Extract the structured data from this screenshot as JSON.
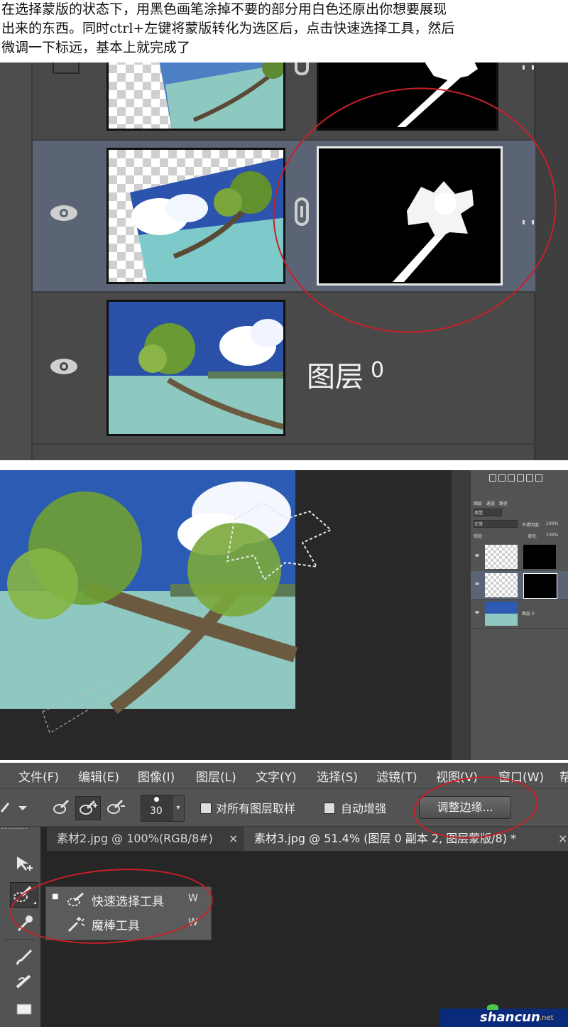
{
  "caption": {
    "line1": "在选择蒙版的状态下，用黑色画笔涂掉不要的部分用白色还原出你想要展现",
    "line2": "出来的东西。同时ctrl+左键将蒙版转化为选区后，点击快速选择工具，然后",
    "line3": "微调一下标远，基本上就完成了"
  },
  "layers_zoom": {
    "layer_name": "图层",
    "layer_number": "0",
    "icons": [
      "eye-icon",
      "link-chain-icon",
      "layer-thumbnail",
      "layer-mask-thumbnail"
    ]
  },
  "mini_panel": {
    "tabs": [
      "图层",
      "通道",
      "路径"
    ],
    "filter_label": "类型",
    "blend_mode": "正常",
    "opacity_label": "不透明度:",
    "opacity_value": "100%",
    "lock_label": "锁定:",
    "fill_label": "填充:",
    "fill_value": "100%",
    "layer_label": "图层 0"
  },
  "menu": {
    "items": [
      "文件(F)",
      "编辑(E)",
      "图像(I)",
      "图层(L)",
      "文字(Y)",
      "选择(S)",
      "滤镜(T)",
      "视图(V)",
      "窗口(W)",
      "帮"
    ]
  },
  "options": {
    "brush_size": "30",
    "sample_all_layers": "对所有图层取样",
    "auto_enhance": "自动增强",
    "refine_edge": "调整边缘..."
  },
  "tabs": {
    "tab1": "素材2.jpg @ 100%(RGB/8#)",
    "tab1_close": "×",
    "tab2": "素材3.jpg @ 51.4% (图层 0 副本 2, 图层蒙版/8) *",
    "tab2_close": "×"
  },
  "flyout": {
    "items": [
      {
        "label": "快速选择工具",
        "shortcut": "W",
        "active": "■"
      },
      {
        "label": "魔棒工具",
        "shortcut": "W",
        "active": ""
      }
    ]
  },
  "watermark": {
    "text": "shancun",
    "suffix": ".net"
  },
  "colors": {
    "annotation_red": "#c8202a",
    "panel_gray": "#494949",
    "selected_row": "#5a6474"
  }
}
